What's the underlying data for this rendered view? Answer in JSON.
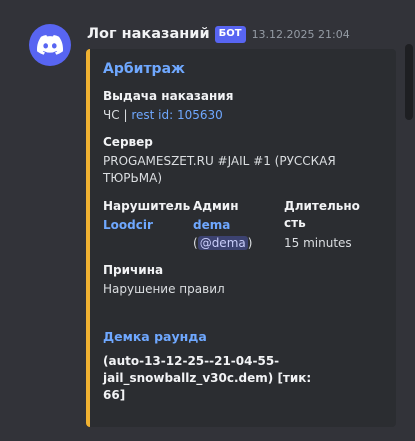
{
  "message": {
    "username": "Лог наказаний",
    "bot_tag": "БОТ",
    "timestamp": "13.12.2025 21:04",
    "avatar_icon": "discord-logo-icon",
    "avatar_color": "#5865f2"
  },
  "embed": {
    "accent_color": "#f0b232",
    "title": "Арбитраж",
    "punishment": {
      "name": "Выдача наказания",
      "type": "ЧС",
      "separator": "|",
      "rest_id": "rest id: 105630"
    },
    "server": {
      "name": "Сервер",
      "value": "PROGAMESZET.RU #JAIL #1 (РУССКАЯ ТЮРЬМА)"
    },
    "violator": {
      "name": "Нарушитель",
      "value": "Loodcir"
    },
    "admin": {
      "name": "Админ",
      "value": "dema",
      "open_paren": "(",
      "mention": "@dema",
      "close_paren": ")"
    },
    "duration": {
      "name": "Длительность",
      "value": "15 minutes"
    },
    "reason": {
      "name": "Причина",
      "value": "Нарушение правил"
    },
    "demo": {
      "title": "Демка раунда",
      "file": "(auto-13-12-25--21-04-55-jail_snowballz_v30c.dem) [тик: 66]"
    }
  }
}
